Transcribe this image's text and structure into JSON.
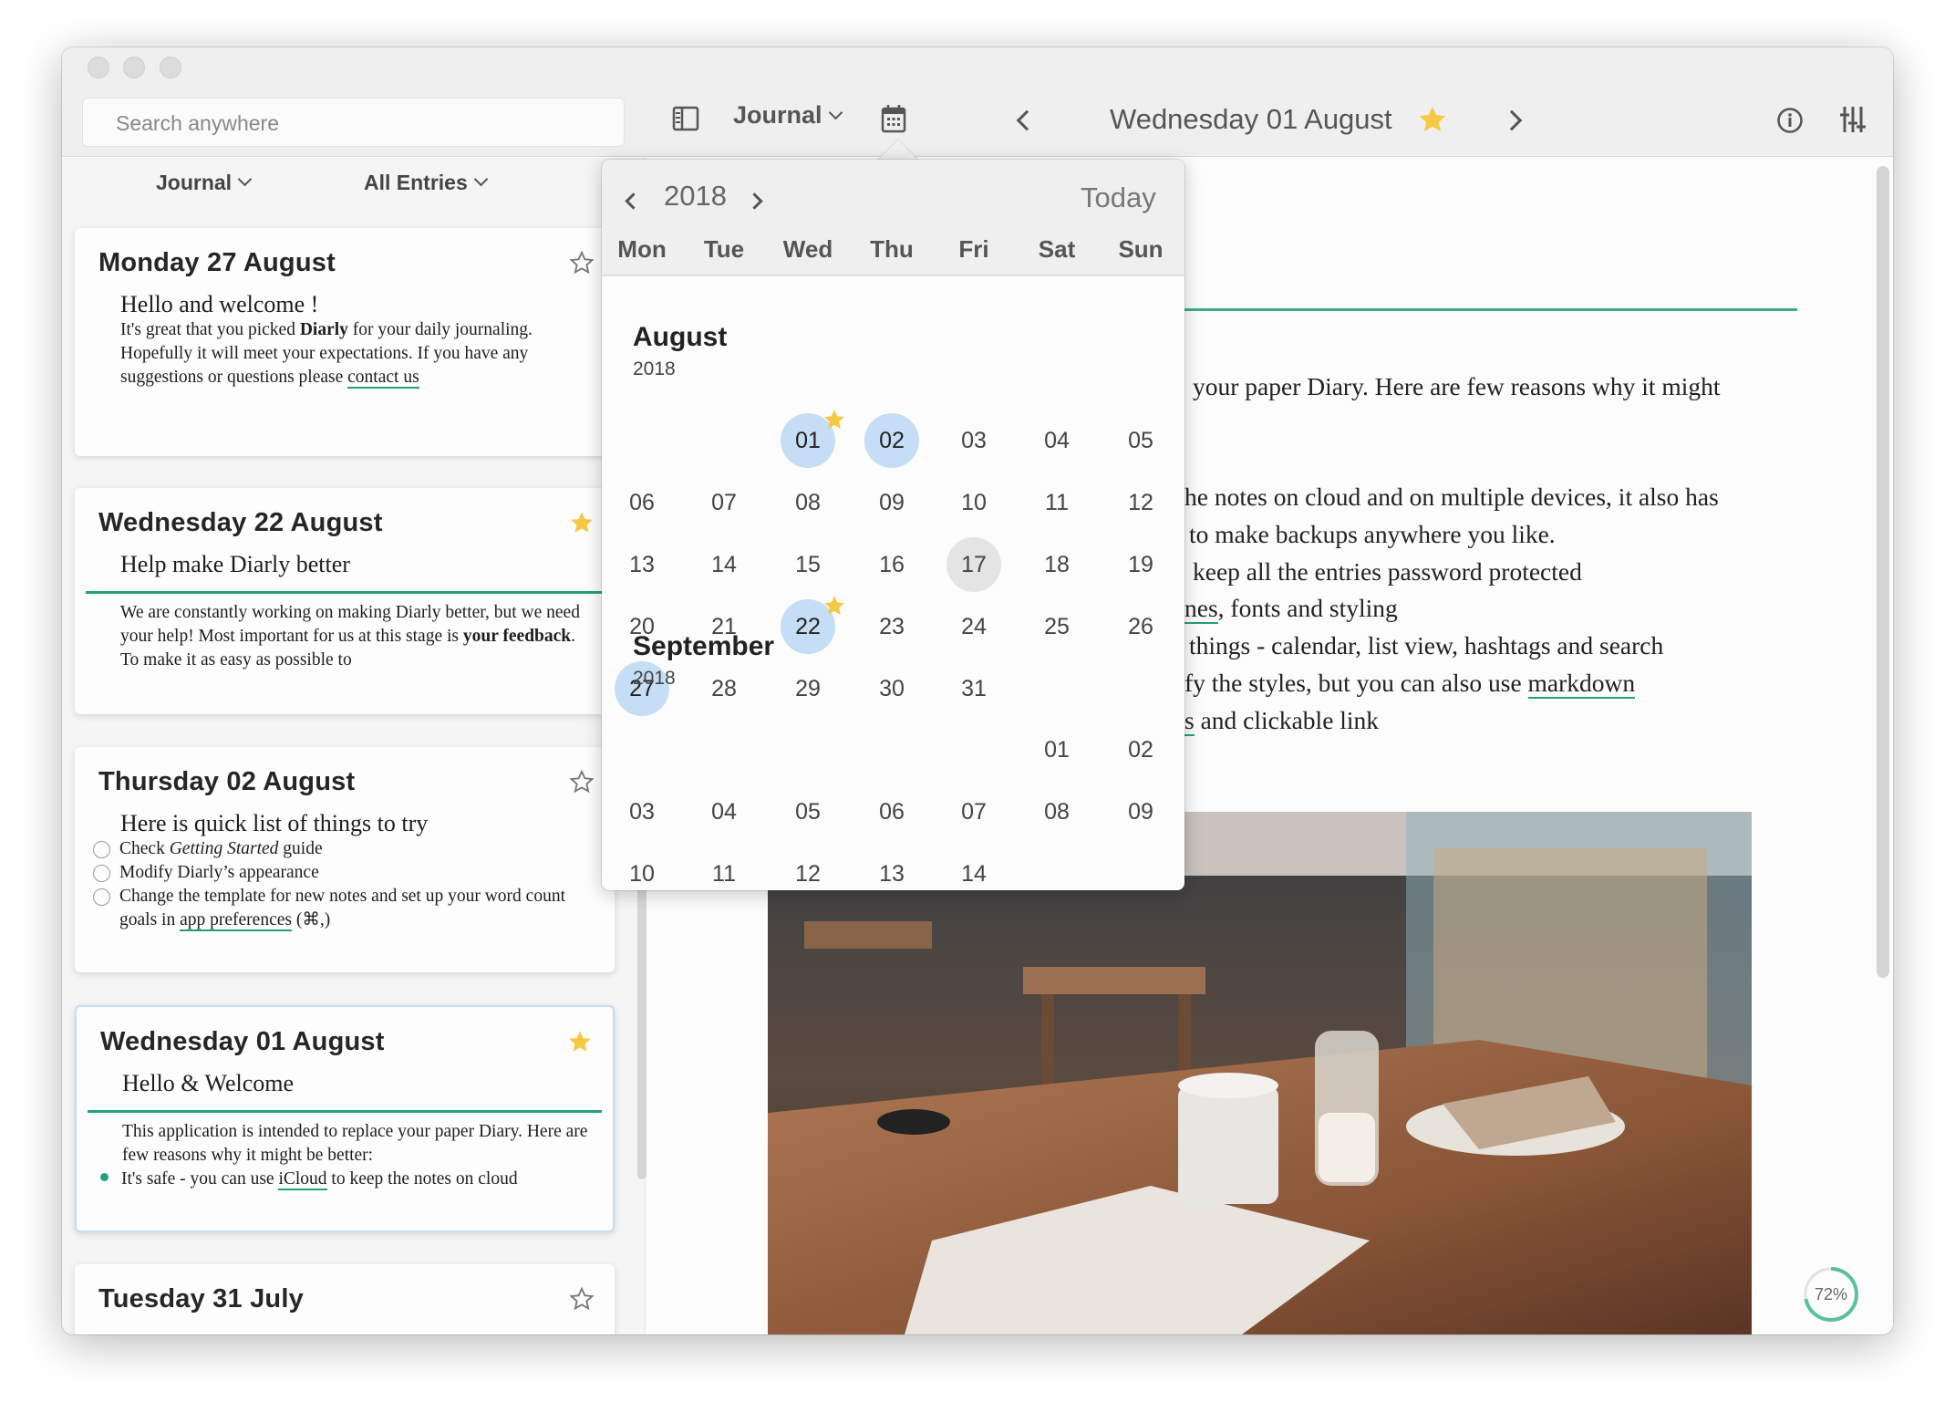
{
  "colors": {
    "accent": "#23a275",
    "star": "#f6c945",
    "selected_day": "#c5def5",
    "today_day": "#e4e4e4",
    "progress": "#5ac0a0"
  },
  "toolbar": {
    "search_placeholder": "Search anywhere",
    "journal_menu": "Journal",
    "entry_title": "Wednesday 01 August",
    "entry_starred": true,
    "icons": [
      "sidebar-toggle-icon",
      "calendar-icon",
      "chevron-left-icon",
      "star-icon",
      "chevron-right-icon",
      "info-icon",
      "sliders-icon"
    ]
  },
  "filters": {
    "journal": "Journal",
    "entries": "All Entries"
  },
  "entries": [
    {
      "date": "Monday 27 August",
      "starred": false,
      "heading": "Hello and welcome !",
      "body": {
        "p1a": "It's great that you picked ",
        "p1b": "Diarly",
        "p1c": " for your daily journaling.",
        "p2a": "Hopefully it will meet your expectations. If you have any suggestions or questions please ",
        "p2link": "contact us"
      }
    },
    {
      "date": "Wednesday 22 August",
      "starred": true,
      "heading": "Help make Diarly better",
      "body": {
        "a": "We are constantly working on making Diarly better, but we need your help! Most important for us at this stage is ",
        "b": "your feedback",
        "c": ". To make it as easy as possible to"
      }
    },
    {
      "date": "Thursday 02 August",
      "starred": false,
      "heading": "Here is quick list of things to try",
      "checklist": [
        {
          "a": "Check ",
          "i": "Getting Started",
          "c": " guide"
        },
        {
          "a": "Modify Diarly’s appearance"
        },
        {
          "a": "Change the template for new notes and set up your word count goals in ",
          "link": "app preferences",
          "c": "  (⌘,)"
        }
      ]
    },
    {
      "date": "Wednesday 01 August",
      "starred": true,
      "selected": true,
      "heading": "Hello & Welcome",
      "body": {
        "a": "This application is intended to replace your paper Diary. Here are few reasons why it might be better:",
        "bullet_a": "It's safe - you can use ",
        "bullet_link": "iCloud",
        "bullet_c": "  to keep the notes on cloud"
      }
    },
    {
      "date": "Tuesday 31 July",
      "starred": false
    }
  ],
  "editor": {
    "lines": [
      {
        "t": "your paper Diary. Here are few reasons why it might"
      },
      {
        "t": "he notes on cloud and on multiple devices, it also has"
      },
      {
        "t": "to make backups anywhere you like."
      },
      {
        "t": "keep all the entries password protected"
      },
      {
        "link": "nes",
        "t": ", fonts and styling"
      },
      {
        "t": "things - calendar, list view, hashtags and search"
      },
      {
        "t": "fy the styles, but you can also use ",
        "link2": "markdown"
      },
      {
        "link": "s",
        "t": " and clickable link"
      }
    ],
    "word_goal_progress": "72%",
    "word_goal_fraction": 0.72
  },
  "calendar": {
    "year": "2018",
    "today_label": "Today",
    "weekdays": [
      "Mon",
      "Tue",
      "Wed",
      "Thu",
      "Fri",
      "Sat",
      "Sun"
    ],
    "months": [
      {
        "name": "August",
        "year": "2018",
        "first_weekday": 2,
        "days": 31,
        "selected": [
          1,
          2,
          22,
          27
        ],
        "today": 17,
        "starred": [
          1,
          22
        ]
      },
      {
        "name": "September",
        "year": "2018",
        "first_weekday": 5,
        "days": 14,
        "selected": [],
        "today": null,
        "starred": []
      }
    ]
  }
}
